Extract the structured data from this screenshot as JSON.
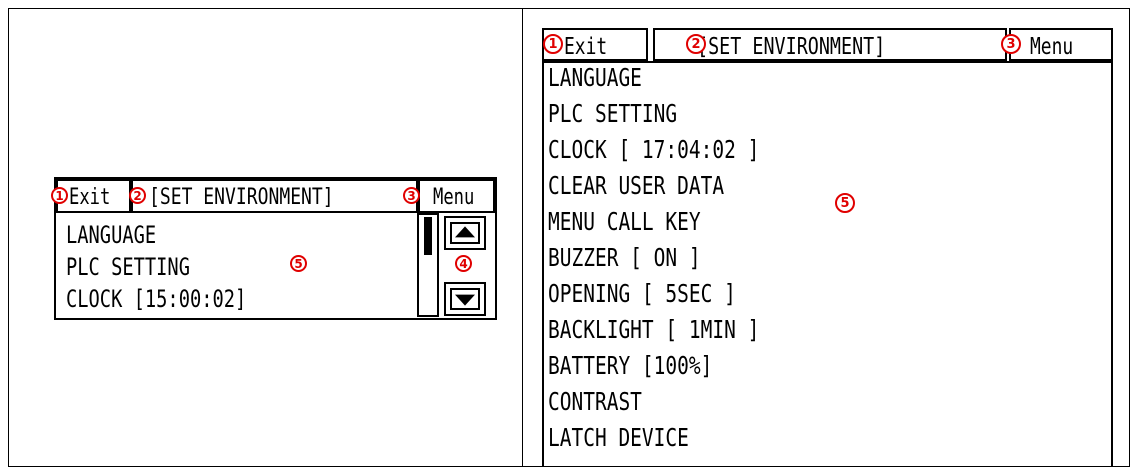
{
  "small_screen": {
    "header": {
      "exit_label": "Exit",
      "title_label": "[SET ENVIRONMENT]",
      "menu_label": "Menu"
    },
    "items": [
      "LANGUAGE",
      "PLC SETTING",
      "CLOCK [15:00:02]"
    ],
    "callouts": {
      "exit": "1",
      "title": "2",
      "menu": "3",
      "scroll": "4",
      "list": "5"
    }
  },
  "large_screen": {
    "header": {
      "exit_label": "Exit",
      "title_label": "[SET ENVIRONMENT]",
      "menu_label": "Menu"
    },
    "items": [
      "LANGUAGE",
      "PLC SETTING",
      "CLOCK [ 17:04:02 ]",
      "CLEAR USER DATA",
      "MENU CALL KEY",
      "BUZZER [ ON ]",
      "OPENING [ 5SEC ]",
      "BACKLIGHT [ 1MIN ]",
      "BATTERY [100%]",
      "CONTRAST",
      "LATCH DEVICE"
    ],
    "callouts": {
      "exit": "1",
      "title": "2",
      "menu": "3",
      "list": "5"
    }
  },
  "colors": {
    "callout": "#e00000",
    "lcd_text": "#000000",
    "background": "#ffffff"
  },
  "icons": {
    "scroll_up": "triangle-up-icon",
    "scroll_down": "triangle-down-icon"
  }
}
